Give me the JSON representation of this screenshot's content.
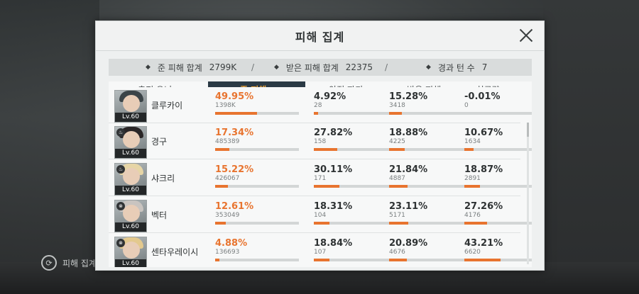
{
  "dialog": {
    "title": "피해 집계"
  },
  "background": {
    "label": "피해 집계"
  },
  "summary": {
    "dealt_label": "준 피해 합계",
    "dealt_value": "2799K",
    "taken_label": "받은 피해 합계",
    "taken_value": "22375",
    "turns_label": "경과 턴 수",
    "turns_value": "7",
    "separator": "/"
  },
  "columns": [
    "출전 유닛",
    "준 피해",
    "안정 파괴",
    "받은 피해",
    "치료량"
  ],
  "active_column": 1,
  "rows": [
    {
      "name": "클루카이",
      "level": "Lv.60",
      "hair": "#3b4448",
      "cls": "",
      "dealt": {
        "pct": "49.95%",
        "raw": "1398K",
        "ratio": 0.4995
      },
      "stab": {
        "pct": "4.92%",
        "raw": "28",
        "ratio": 0.0492
      },
      "taken": {
        "pct": "15.28%",
        "raw": "3418",
        "ratio": 0.1528
      },
      "heal": {
        "pct": "-0.01%",
        "raw": "0",
        "ratio": 0.0
      }
    },
    {
      "name": "경구",
      "level": "Lv.60",
      "hair": "#2a2627",
      "cls": "♨",
      "dealt": {
        "pct": "17.34%",
        "raw": "485389",
        "ratio": 0.1734
      },
      "stab": {
        "pct": "27.82%",
        "raw": "158",
        "ratio": 0.2782
      },
      "taken": {
        "pct": "18.88%",
        "raw": "4225",
        "ratio": 0.1888
      },
      "heal": {
        "pct": "10.67%",
        "raw": "1634",
        "ratio": 0.1067
      }
    },
    {
      "name": "샤크리",
      "level": "Lv.60",
      "hair": "#e6d5a6",
      "cls": "♨",
      "dealt": {
        "pct": "15.22%",
        "raw": "426067",
        "ratio": 0.1522
      },
      "stab": {
        "pct": "30.11%",
        "raw": "171",
        "ratio": 0.3011
      },
      "taken": {
        "pct": "21.84%",
        "raw": "4887",
        "ratio": 0.2184
      },
      "heal": {
        "pct": "18.87%",
        "raw": "2891",
        "ratio": 0.1887
      }
    },
    {
      "name": "벡터",
      "level": "Lv.60",
      "hair": "#c9c4c0",
      "cls": "⊗",
      "dealt": {
        "pct": "12.61%",
        "raw": "353049",
        "ratio": 0.1261
      },
      "stab": {
        "pct": "18.31%",
        "raw": "104",
        "ratio": 0.1831
      },
      "taken": {
        "pct": "23.11%",
        "raw": "5171",
        "ratio": 0.2311
      },
      "heal": {
        "pct": "27.26%",
        "raw": "4176",
        "ratio": 0.2726
      }
    },
    {
      "name": "센타우레이시",
      "level": "Lv.60",
      "hair": "#e3c98e",
      "cls": "⊗",
      "dealt": {
        "pct": "4.88%",
        "raw": "136693",
        "ratio": 0.0488
      },
      "stab": {
        "pct": "18.84%",
        "raw": "107",
        "ratio": 0.1884
      },
      "taken": {
        "pct": "20.89%",
        "raw": "4676",
        "ratio": 0.2089
      },
      "heal": {
        "pct": "43.21%",
        "raw": "6620",
        "ratio": 0.4321
      }
    }
  ],
  "colors": {
    "accent": "#e8742f",
    "active_header": "#2b3a45",
    "active_header_text": "#f1a63a"
  }
}
